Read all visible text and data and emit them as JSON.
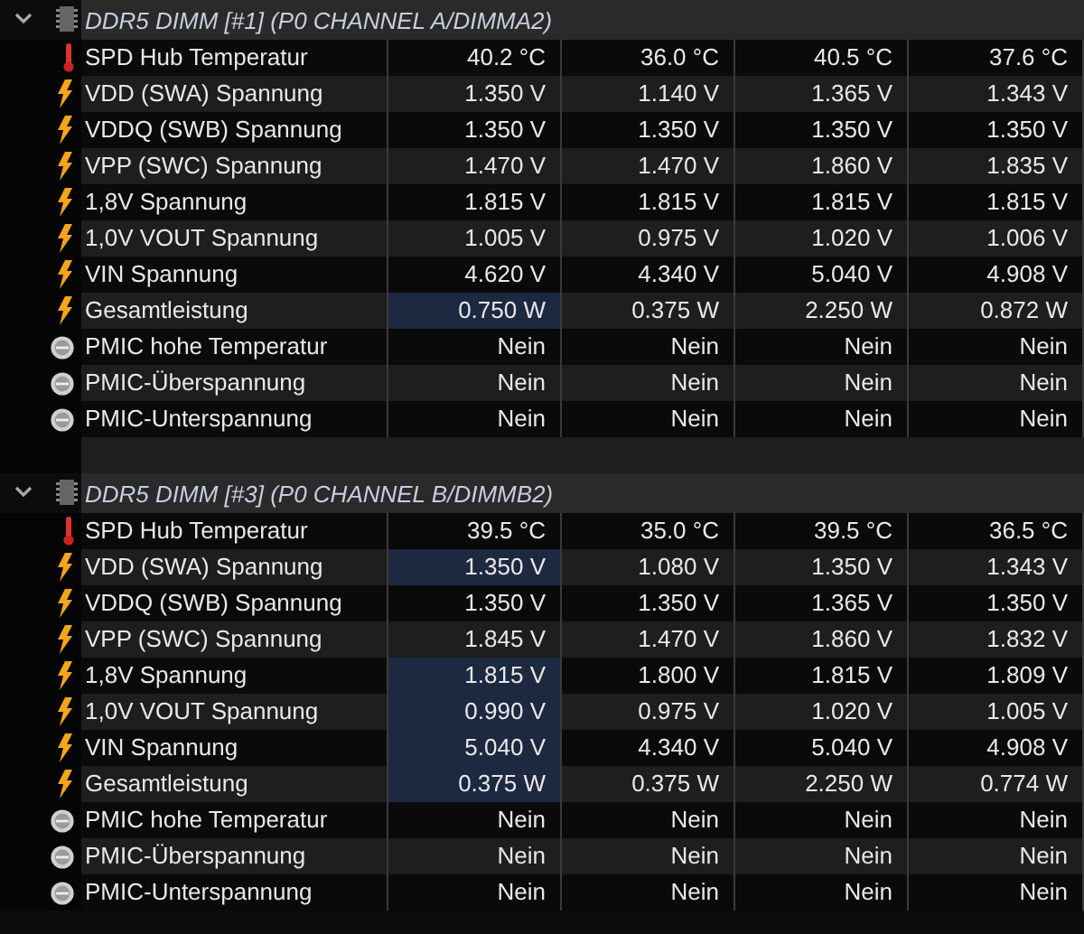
{
  "sections": [
    {
      "title": "DDR5 DIMM [#1] (P0 CHANNEL A/DIMMA2)",
      "expanded": true,
      "rows": [
        {
          "kind": "temp",
          "label": "SPD Hub Temperatur",
          "highlighted": false,
          "values": [
            "40.2 °C",
            "36.0 °C",
            "40.5 °C",
            "37.6 °C"
          ]
        },
        {
          "kind": "bolt",
          "label": "VDD (SWA) Spannung",
          "highlighted": false,
          "values": [
            "1.350 V",
            "1.140 V",
            "1.365 V",
            "1.343 V"
          ]
        },
        {
          "kind": "bolt",
          "label": "VDDQ (SWB) Spannung",
          "highlighted": false,
          "values": [
            "1.350 V",
            "1.350 V",
            "1.350 V",
            "1.350 V"
          ]
        },
        {
          "kind": "bolt",
          "label": "VPP (SWC) Spannung",
          "highlighted": false,
          "values": [
            "1.470 V",
            "1.470 V",
            "1.860 V",
            "1.835 V"
          ]
        },
        {
          "kind": "bolt",
          "label": "1,8V Spannung",
          "highlighted": false,
          "values": [
            "1.815 V",
            "1.815 V",
            "1.815 V",
            "1.815 V"
          ]
        },
        {
          "kind": "bolt",
          "label": "1,0V VOUT Spannung",
          "highlighted": false,
          "values": [
            "1.005 V",
            "0.975 V",
            "1.020 V",
            "1.006 V"
          ]
        },
        {
          "kind": "bolt",
          "label": "VIN Spannung",
          "highlighted": false,
          "values": [
            "4.620 V",
            "4.340 V",
            "5.040 V",
            "4.908 V"
          ]
        },
        {
          "kind": "bolt",
          "label": "Gesamtleistung",
          "highlighted": true,
          "values": [
            "0.750 W",
            "0.375 W",
            "2.250 W",
            "0.872 W"
          ]
        },
        {
          "kind": "flag",
          "label": "PMIC hohe Temperatur",
          "highlighted": false,
          "values": [
            "Nein",
            "Nein",
            "Nein",
            "Nein"
          ]
        },
        {
          "kind": "flag",
          "label": "PMIC-Überspannung",
          "highlighted": false,
          "values": [
            "Nein",
            "Nein",
            "Nein",
            "Nein"
          ]
        },
        {
          "kind": "flag",
          "label": "PMIC-Unterspannung",
          "highlighted": false,
          "values": [
            "Nein",
            "Nein",
            "Nein",
            "Nein"
          ]
        }
      ]
    },
    {
      "title": "DDR5 DIMM [#3] (P0 CHANNEL B/DIMMB2)",
      "expanded": true,
      "rows": [
        {
          "kind": "temp",
          "label": "SPD Hub Temperatur",
          "highlighted": false,
          "values": [
            "39.5 °C",
            "35.0 °C",
            "39.5 °C",
            "36.5 °C"
          ]
        },
        {
          "kind": "bolt",
          "label": "VDD (SWA) Spannung",
          "highlighted": true,
          "values": [
            "1.350 V",
            "1.080 V",
            "1.350 V",
            "1.343 V"
          ]
        },
        {
          "kind": "bolt",
          "label": "VDDQ (SWB) Spannung",
          "highlighted": false,
          "values": [
            "1.350 V",
            "1.350 V",
            "1.365 V",
            "1.350 V"
          ]
        },
        {
          "kind": "bolt",
          "label": "VPP (SWC) Spannung",
          "highlighted": false,
          "values": [
            "1.845 V",
            "1.470 V",
            "1.860 V",
            "1.832 V"
          ]
        },
        {
          "kind": "bolt",
          "label": "1,8V Spannung",
          "highlighted": true,
          "values": [
            "1.815 V",
            "1.800 V",
            "1.815 V",
            "1.809 V"
          ]
        },
        {
          "kind": "bolt",
          "label": "1,0V VOUT Spannung",
          "highlighted": true,
          "values": [
            "0.990 V",
            "0.975 V",
            "1.020 V",
            "1.005 V"
          ]
        },
        {
          "kind": "bolt",
          "label": "VIN Spannung",
          "highlighted": true,
          "values": [
            "5.040 V",
            "4.340 V",
            "5.040 V",
            "4.908 V"
          ]
        },
        {
          "kind": "bolt",
          "label": "Gesamtleistung",
          "highlighted": true,
          "values": [
            "0.375 W",
            "0.375 W",
            "2.250 W",
            "0.774 W"
          ]
        },
        {
          "kind": "flag",
          "label": "PMIC hohe Temperatur",
          "highlighted": false,
          "values": [
            "Nein",
            "Nein",
            "Nein",
            "Nein"
          ]
        },
        {
          "kind": "flag",
          "label": "PMIC-Überspannung",
          "highlighted": false,
          "values": [
            "Nein",
            "Nein",
            "Nein",
            "Nein"
          ]
        },
        {
          "kind": "flag",
          "label": "PMIC-Unterspannung",
          "highlighted": false,
          "values": [
            "Nein",
            "Nein",
            "Nein",
            "Nein"
          ]
        }
      ]
    }
  ]
}
